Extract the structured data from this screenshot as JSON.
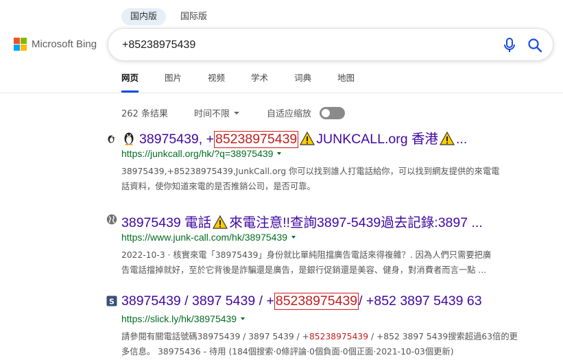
{
  "region_tabs": [
    "国内版",
    "国际版"
  ],
  "logo": {
    "text": "Microsoft Bing"
  },
  "search": {
    "value": "+85238975439"
  },
  "nav_tabs": [
    "网页",
    "图片",
    "视频",
    "学术",
    "词典",
    "地图"
  ],
  "tools": {
    "count": "262 条结果",
    "time_filter": "时间不限",
    "adaptive": "自适应缩放"
  },
  "results": [
    {
      "title_prefix": "38975439, +",
      "title_hl": "85238975439",
      "title_mid": " JUNKCALL.org 香港 ",
      "title_end": "...",
      "url": "https://junkcall.org/hk/?q=38975439",
      "snippet1": "38975439,+85238975439,JunkCall.org 你可以找到誰人打電話給你，可以找到網友提供的來電電",
      "snippet2": "話資料，使你知道來電的是否推銷公司，是否可靠。"
    },
    {
      "title_a": "38975439 電話",
      "title_b": "來電注意!!查詢3897-5439過去記錄:3897 ...",
      "url": "https://www.junk-call.com/hk/38975439",
      "snippet1": "2022-10-3 · 核實來電「38975439」身份就比單純阻擋廣告電話來得複雜？. 因為人們只需要把廣",
      "snippet2": "告電話擋掉就好，至於它背後是詐騙還是廣告，是銀行促銷還是美容、健身，對消費者而言一點 ..."
    },
    {
      "title_prefix": "38975439 / 3897 5439 / +",
      "title_hl": "85238975439",
      "title_suffix": " / +852 3897 5439 63",
      "url": "https://slick.ly/hk/38975439",
      "snippet1_a": "請參閱有關電話號碼38975439 / 3897 5439 / +",
      "snippet1_red": "85238975439",
      "snippet1_b": " / +852 3897 5439搜索超過63倍的更",
      "snippet2": "多信息。 38975436 - 待用 (184個搜索·0條評論·0個負面·0個正面·2021-10-03個更新)"
    }
  ]
}
